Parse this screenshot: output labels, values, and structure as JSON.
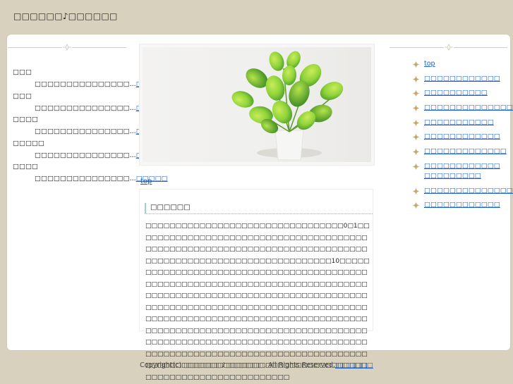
{
  "site": {
    "title": "□□□□□□♪□□□□□□"
  },
  "left": {
    "entries": [
      {
        "title": "□□□",
        "excerpt": "□□□□□□□□□□□□□□□...",
        "more": "□□□□□"
      },
      {
        "title": "□□□",
        "excerpt": "□□□□□□□□□□□□□□□...",
        "more": "□□□□□"
      },
      {
        "title": "□□□□",
        "excerpt": "□□□□□□□□□□□□□□□...",
        "more": "□□□□□"
      },
      {
        "title": "□□□□□",
        "excerpt": "□□□□□□□□□□□□□□□...",
        "more": "□□□□□"
      },
      {
        "title": "□□□□",
        "excerpt": "□□□□□□□□□□□□□□□...",
        "more": "□□□□□"
      }
    ]
  },
  "main": {
    "top_link": "top",
    "article_title": "□□□□□□",
    "article_body": "□□□□□□□□□□□□□□□□□□□□□□□□□□□□□□□□□0□1□□□□□□□□□□□□□□□□□□□□□□□□□□□□□□□□□□□□□□□□□□□□□□□□□□□□□□□□□□□□□□□□□□□□□□□□□□□□□□□□□□□□□□□□□□□□□□□□□□□□□□□□□□□10□□□□□□□□□□□□□□□□□□□□□□□□□□□□□□□□□□□□□□□□□□□□□□□□□□□□□□□□□□□□□□□□□□□□□□□□□□□□□□□□□□□□□□□□□□□□□□□□□□□□□□□□□□□□□□□□□□□□□□□□□□□□□□□□□□□□□□□□□□□□□□□□□□□□□□□□□□□□□□□□□□□□□□□□□□□□□□□□□□□□□□□□□□□□□□□□□□□□□□□□□□□□□□□□□□□□□□□□□□□□□□□□□□□□□□□□□□□□□□□□□□□□□□□□□□□□□□□□□□□□□□□□□□□□□□□□□□□□□□□□□□□□□□□□□□□□□□□□□□□□□□□□□□□□□□□□□□□□□□□□□□□□□□□□□□□□□□□□□□□□□□□□□□□□□□□□□□□□□□□□□□"
  },
  "right": {
    "links": [
      "top",
      "□□□□□□□□□□□□",
      "□□□□□□□□□□",
      "□□□□□□□□□□□□□□□□□",
      "□□□□□□□□□□□",
      "□□□□□□□□□□□□",
      "□□□□□□□□□□□□□",
      "□□□□□□□□□□□□□□□□□□□□□",
      "□□□□□□□□□□□□□□□□",
      "□□□□□□□□□□□□"
    ]
  },
  "footer": {
    "copyright": "Copyright(c) □□□□□□♪□□□□□□. All Rights Reserved.",
    "link": "□□□□□□"
  },
  "colors": {
    "page_background": "#d8d1bd",
    "card_background": "#ffffff",
    "link": "#1a5fd1",
    "bullet": "#c7a66a",
    "heading_accent": "#9fd2c6"
  },
  "icons": {
    "divider": "ornament-icon",
    "bullet": "diamond-flower-icon",
    "hero": "plant-photo"
  }
}
